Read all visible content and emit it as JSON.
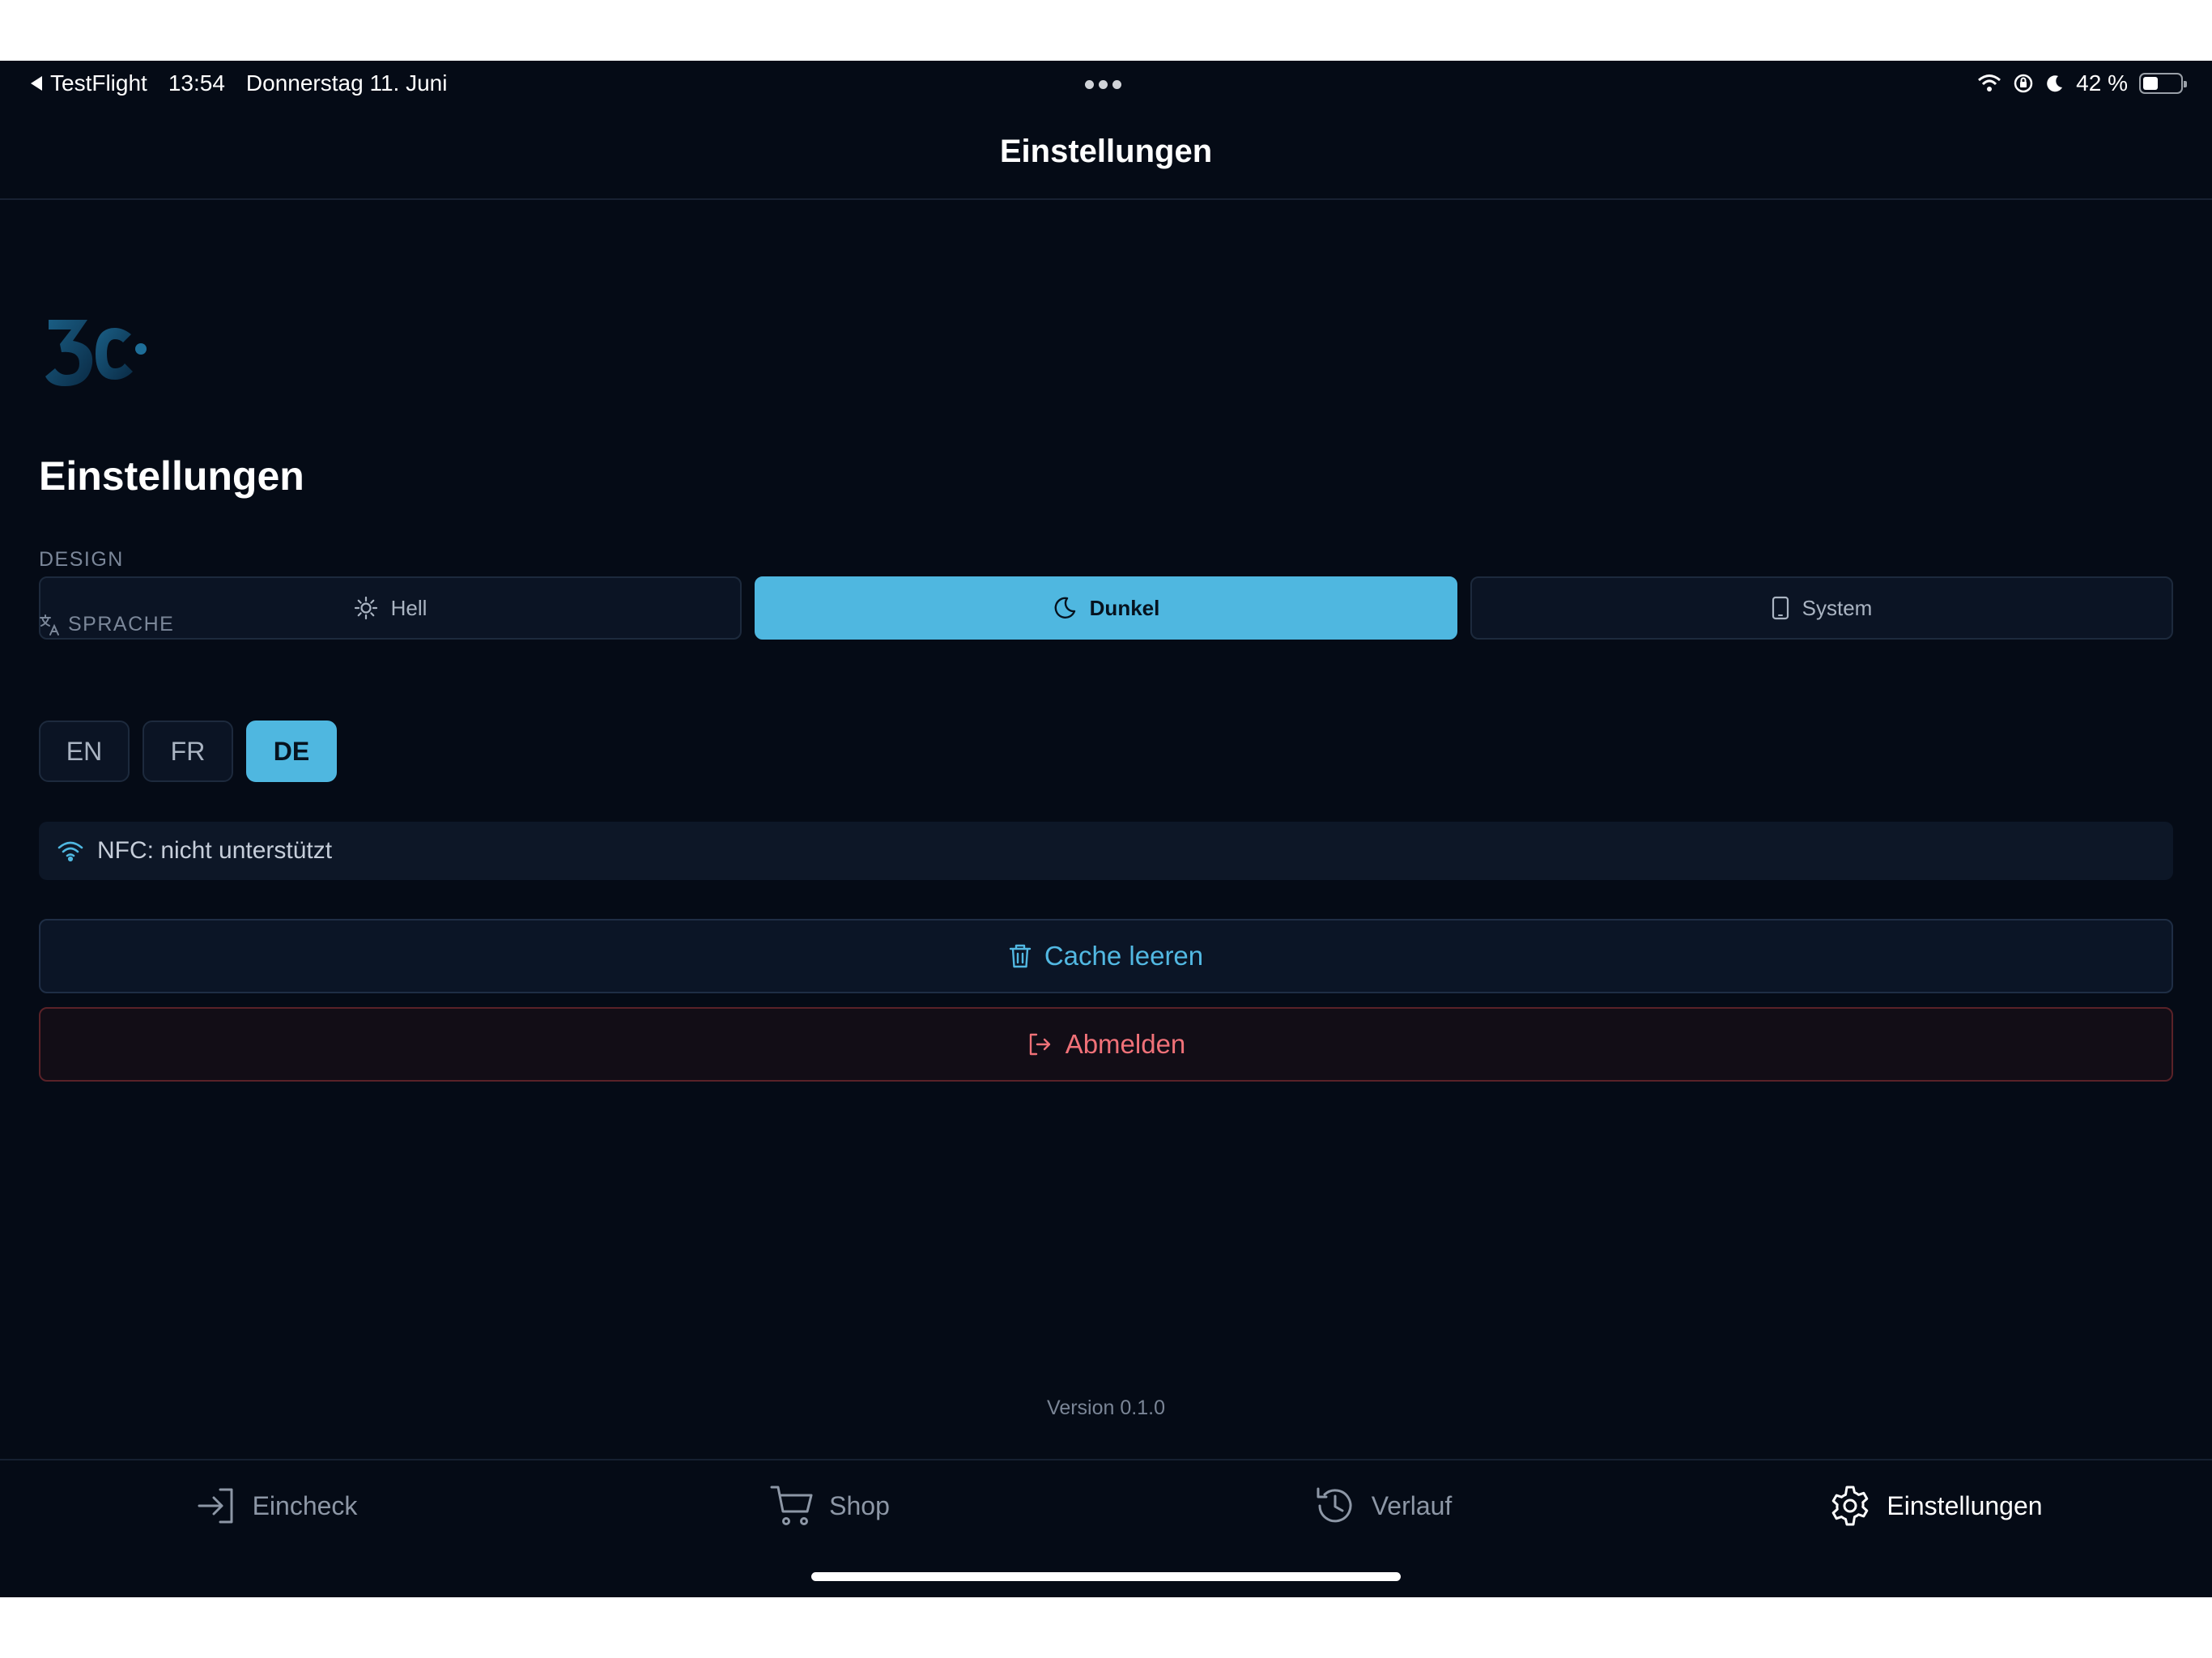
{
  "status_bar": {
    "back_app": "TestFlight",
    "time": "13:54",
    "date": "Donnerstag 11. Juni",
    "battery": "42 %",
    "battery_level": 0.42
  },
  "nav": {
    "title": "Einstellungen"
  },
  "page": {
    "title": "Einstellungen",
    "design_label": "DESIGN",
    "language_label": "SPRACHE"
  },
  "theme_options": [
    {
      "label": "Hell",
      "icon": "sun-icon",
      "selected": false
    },
    {
      "label": "Dunkel",
      "icon": "moon-icon",
      "selected": true
    },
    {
      "label": "System",
      "icon": "device-icon",
      "selected": false
    }
  ],
  "languages": [
    {
      "label": "EN",
      "selected": false
    },
    {
      "label": "FR",
      "selected": false
    },
    {
      "label": "DE",
      "selected": true
    }
  ],
  "nfc": {
    "status": "NFC: nicht unterstützt",
    "icon": "wifi-icon"
  },
  "actions": {
    "clear_cache": "Cache leeren",
    "logout": "Abmelden"
  },
  "version": "Version 0.1.0",
  "tabs": [
    {
      "label": "Eincheck",
      "icon": "login-icon",
      "active": false
    },
    {
      "label": "Shop",
      "icon": "cart-icon",
      "active": false
    },
    {
      "label": "Verlauf",
      "icon": "history-icon",
      "active": false
    },
    {
      "label": "Einstellungen",
      "icon": "gear-icon",
      "active": true
    }
  ],
  "colors": {
    "background": "#050b16",
    "accent": "#4fb7e0",
    "danger": "#f07178",
    "panel": "#0b1424"
  }
}
